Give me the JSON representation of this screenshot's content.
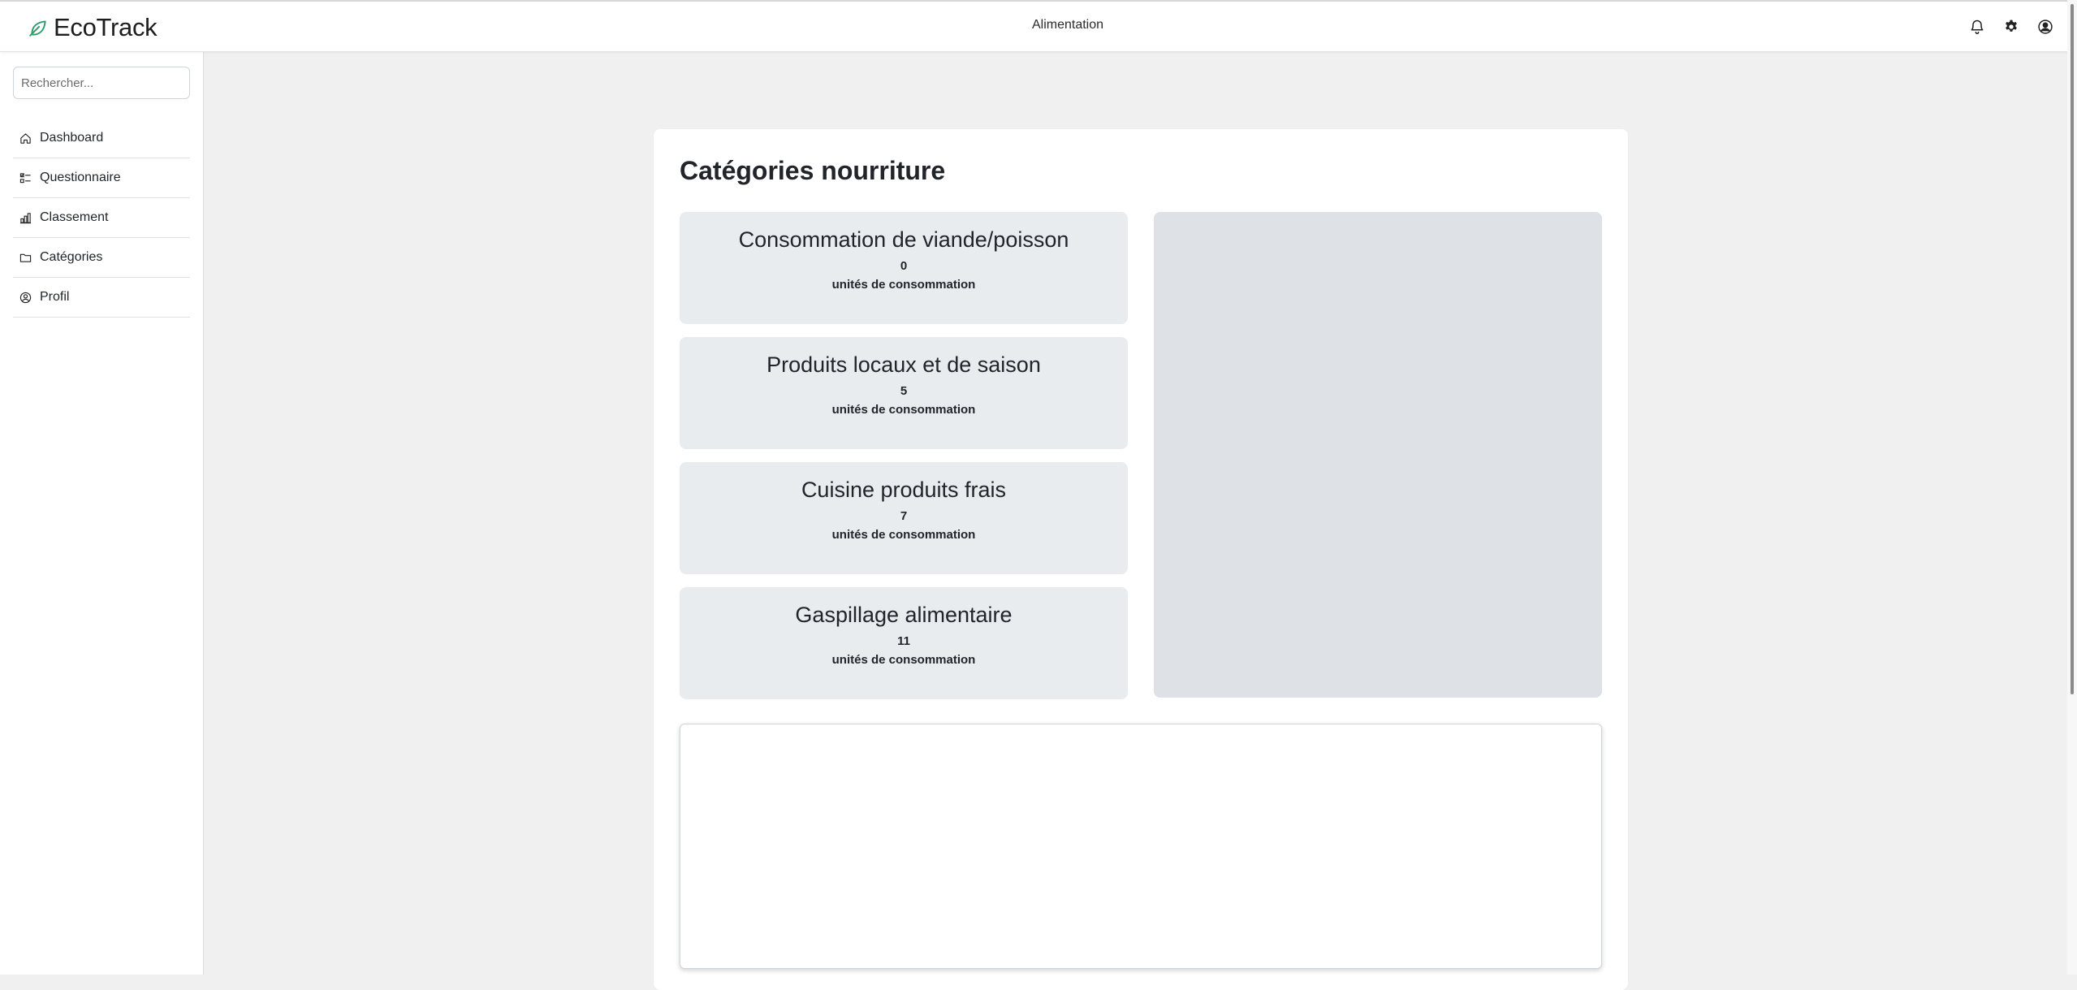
{
  "app": {
    "brand": "EcoTrack",
    "page_title": "Alimentation",
    "brand_color": "#2a9d6b"
  },
  "header": {
    "icons": [
      "bell-icon",
      "gear-icon",
      "user-circle-icon"
    ]
  },
  "sidebar": {
    "search_placeholder": "Rechercher...",
    "items": [
      {
        "label": "Dashboard",
        "icon": "home-icon"
      },
      {
        "label": "Questionnaire",
        "icon": "list-check-icon"
      },
      {
        "label": "Classement",
        "icon": "bar-chart-icon"
      },
      {
        "label": "Catégories",
        "icon": "folder-icon"
      },
      {
        "label": "Profil",
        "icon": "user-circle-icon"
      }
    ]
  },
  "main": {
    "title": "Catégories nourriture",
    "categories": [
      {
        "title": "Consommation de viande/poisson",
        "value": "0",
        "unit": "unités de consommation"
      },
      {
        "title": "Produits locaux et de saison",
        "value": "5",
        "unit": "unités de consommation"
      },
      {
        "title": "Cuisine produits frais",
        "value": "7",
        "unit": "unités de consommation"
      },
      {
        "title": "Gaspillage alimentaire",
        "value": "11",
        "unit": "unités de consommation"
      }
    ]
  }
}
